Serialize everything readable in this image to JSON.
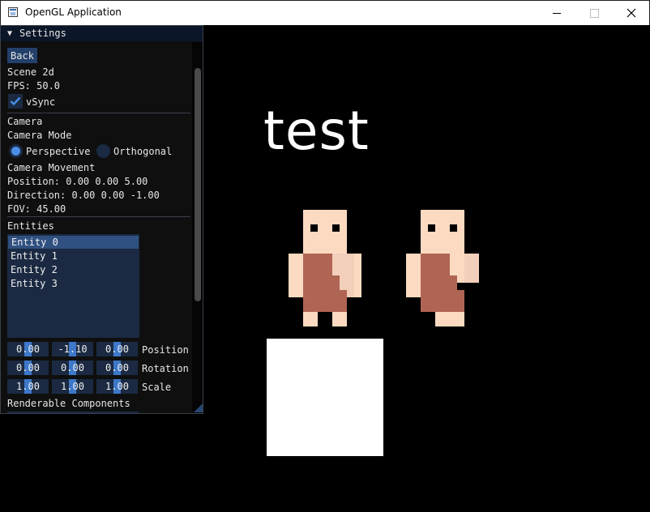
{
  "window": {
    "title": "OpenGL Application",
    "minimize": "—",
    "maximize": "☐",
    "close": "✕"
  },
  "settings": {
    "title": "Settings",
    "back_label": "Back",
    "scene_label": "Scene 2d",
    "fps_label": "FPS: 50.0",
    "vsync_label": "vSync",
    "vsync_checked": true,
    "camera_header": "Camera",
    "camera_mode_label": "Camera Mode",
    "modes": [
      {
        "label": "Perspective",
        "selected": true
      },
      {
        "label": "Orthogonal",
        "selected": false
      }
    ],
    "camera_movement_label": "Camera Movement",
    "position_text": "Position: 0.00 0.00 5.00",
    "direction_text": "Direction: 0.00 0.00 -1.00",
    "fov_text": "FOV: 45.00",
    "entities_header": "Entities",
    "entities": [
      "Entity 0",
      "Entity 1",
      "Entity 2",
      "Entity 3"
    ],
    "selected_entity": 0,
    "transform": {
      "position": {
        "label": "Position",
        "values": [
          "0.00",
          "-1.10",
          "0.00"
        ]
      },
      "rotation": {
        "label": "Rotation",
        "values": [
          "0.00",
          "0.00",
          "0.00"
        ]
      },
      "scale": {
        "label": "Scale",
        "values": [
          "1.00",
          "1.00",
          "1.00"
        ]
      }
    },
    "renderable_label": "Renderable Components"
  },
  "scene": {
    "text": "test",
    "colors": {
      "skin": "#fbdac1",
      "skin_shade": "#f2cfbb",
      "tunic": "#b06554",
      "eye": "#000000"
    }
  }
}
